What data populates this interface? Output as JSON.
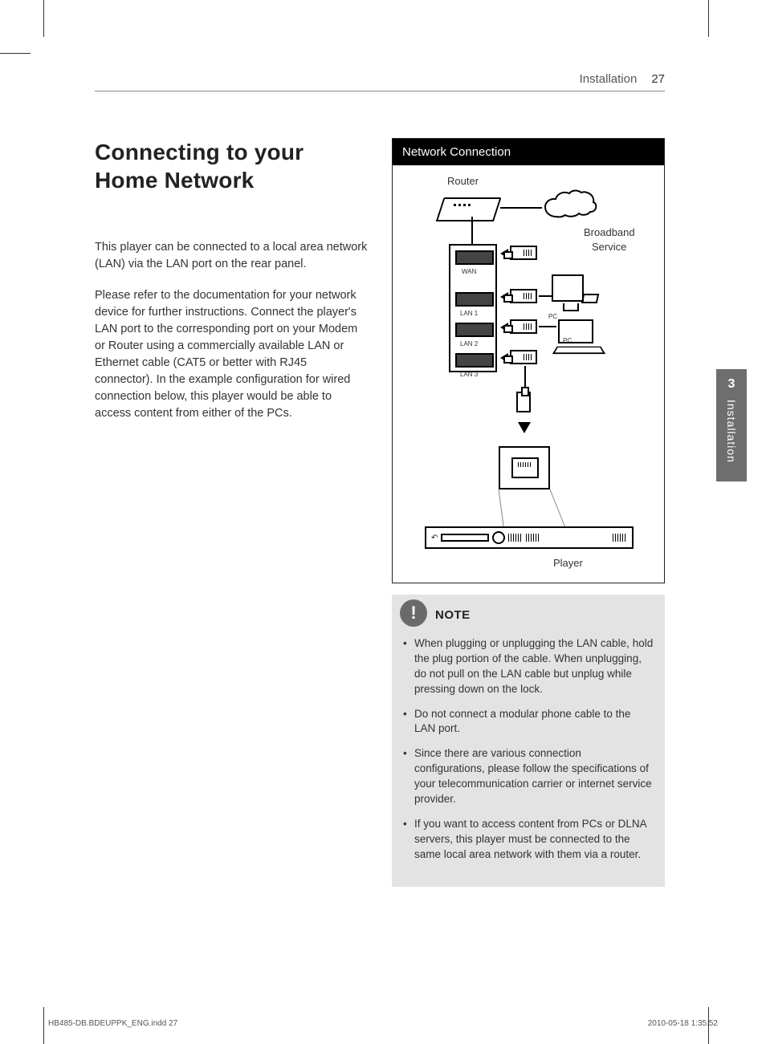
{
  "header": {
    "section": "Installation",
    "page": "27"
  },
  "title": "Connecting to your Home Network",
  "para1": "This player can be connected to a local area network (LAN) via the LAN port on the rear panel.",
  "para2": "Please refer to the documentation for your network device for further instructions. Connect the player's LAN port to the corresponding port on your Modem or Router using a commercially available LAN or Ethernet cable (CAT5 or better with RJ45 connector). In the example configuration for wired connection below, this player would be able to access content from either of the PCs.",
  "diagram": {
    "title": "Network Connection",
    "router": "Router",
    "broadband1": "Broadband",
    "broadband2": "Service",
    "wan": "WAN",
    "lan1": "LAN 1",
    "lan2": "LAN 2",
    "lan3": "LAN 3",
    "pc1": "PC",
    "pc2": "PC",
    "player": "Player"
  },
  "note": {
    "title": "NOTE",
    "items": [
      "When plugging or unplugging the LAN cable, hold the plug portion of the cable. When unplugging, do not pull on the LAN cable but unplug while pressing down on the lock.",
      "Do not connect a modular phone cable to the LAN port.",
      "Since there are various connection configurations, please follow the specifications of your telecommunication carrier or internet service provider.",
      "If you want to access content from PCs or DLNA servers, this player must be connected to the same local area network with them via a router."
    ]
  },
  "sidetab": {
    "num": "3",
    "label": "Installation"
  },
  "footer": {
    "file": "HB485-DB.BDEUPPK_ENG.indd   27",
    "stamp": "2010-05-18    1:35:52"
  }
}
